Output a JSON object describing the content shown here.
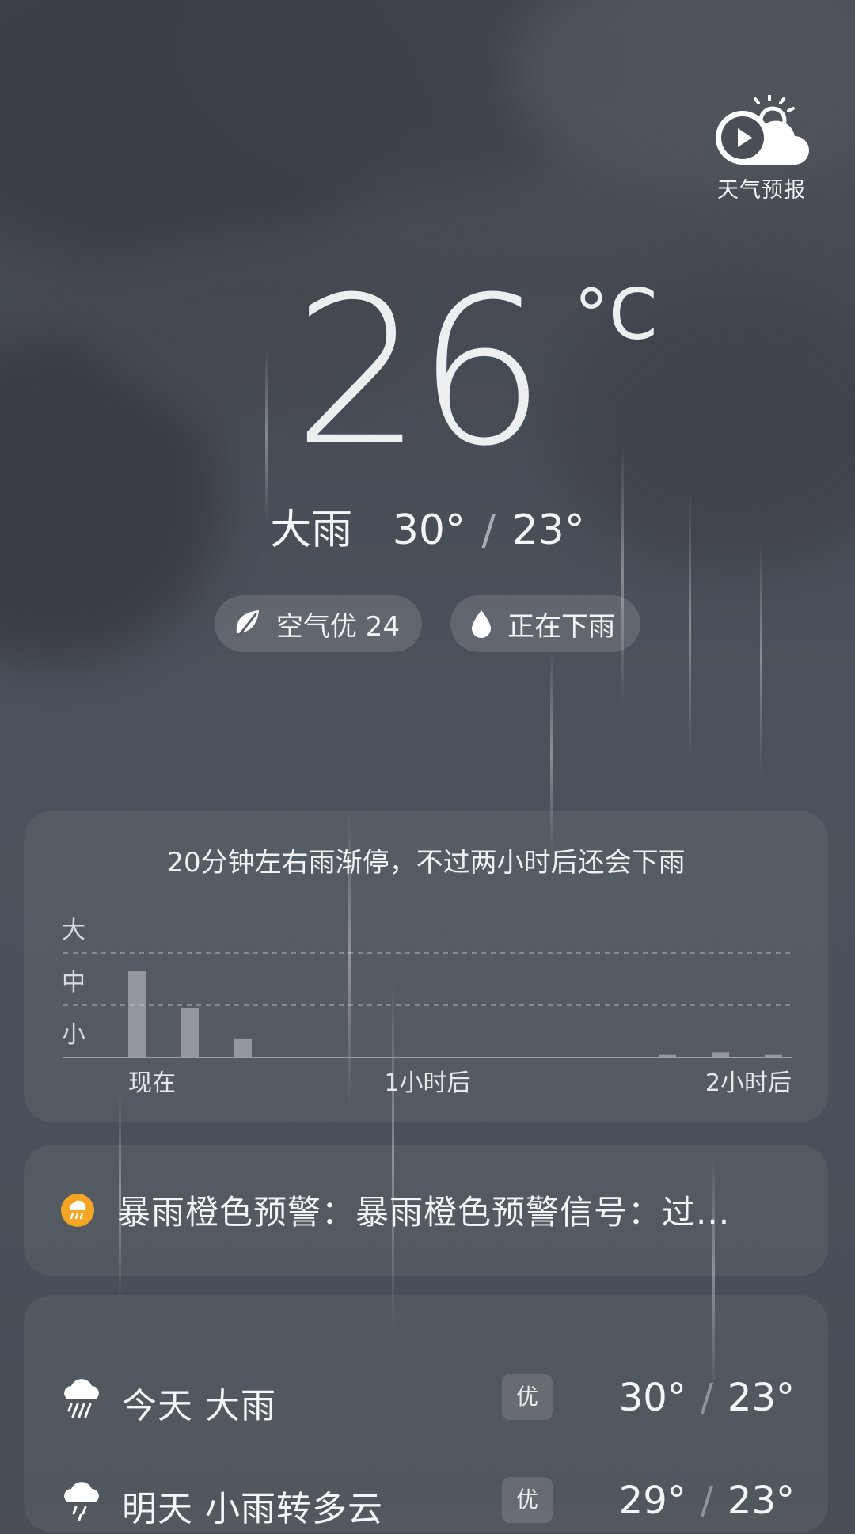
{
  "brand": {
    "label": "天气预报"
  },
  "current": {
    "temperature": "26",
    "unit": "°C",
    "condition": "大雨",
    "high": "30°",
    "low": "23°"
  },
  "pills": {
    "air": "空气优 24",
    "rain": "正在下雨"
  },
  "precip": {
    "summary": "20分钟左右雨渐停，不过两小时后还会下雨",
    "y_levels": [
      "大",
      "中",
      "小"
    ],
    "x_labels": [
      "现在",
      "1小时后",
      "2小时后"
    ]
  },
  "chart_data": {
    "type": "bar",
    "title": "20分钟左右雨渐停，不过两小时后还会下雨",
    "xlabel": "",
    "ylabel": "",
    "ylim": [
      0,
      3
    ],
    "y_tick_labels": [
      "小",
      "中",
      "大"
    ],
    "x_tick_labels": [
      "现在",
      "1小时后",
      "2小时后"
    ],
    "x_range_minutes": [
      0,
      120
    ],
    "grid": true,
    "minutes": [
      0,
      10,
      20,
      100,
      110,
      120
    ],
    "values": [
      1.65,
      0.95,
      0.35,
      0.05,
      0.1,
      0.05
    ]
  },
  "alert": {
    "text": "暴雨橙色预警：暴雨橙色预警信号：过...",
    "color": "#f5a524"
  },
  "days": [
    {
      "name": "今天  大雨",
      "aq": "优",
      "high": "30°",
      "low": "23°",
      "icon": "heavy-rain-icon"
    },
    {
      "name": "明天  小雨转多云",
      "aq": "优",
      "high": "29°",
      "low": "23°",
      "icon": "light-rain-icon"
    }
  ],
  "slash": "/"
}
